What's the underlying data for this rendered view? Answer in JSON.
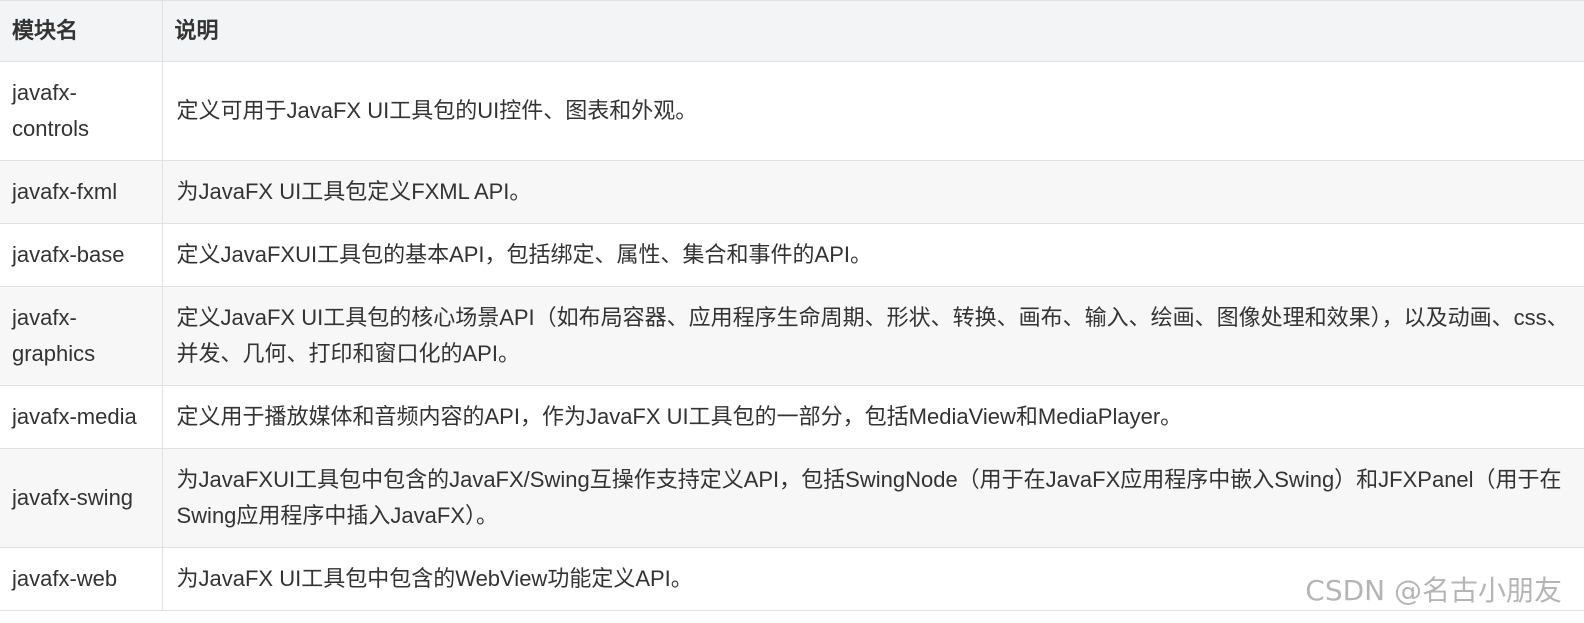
{
  "table": {
    "headers": [
      "模块名",
      "说明"
    ],
    "rows": [
      {
        "module": "javafx-\ncontrols",
        "desc": "定义可用于JavaFX UI工具包的UI控件、图表和外观。"
      },
      {
        "module": "javafx-fxml",
        "desc": "为JavaFX UI工具包定义FXML API。"
      },
      {
        "module": "javafx-base",
        "desc": "定义JavaFXUI工具包的基本API，包括绑定、属性、集合和事件的API。"
      },
      {
        "module": "javafx-\ngraphics",
        "desc": "定义JavaFX UI工具包的核心场景API（如布局容器、应用程序生命周期、形状、转换、画布、输入、绘画、图像处理和效果），以及动画、css、并发、几何、打印和窗口化的API。"
      },
      {
        "module": "javafx-media",
        "desc": "定义用于播放媒体和音频内容的API，作为JavaFX UI工具包的一部分，包括MediaView和MediaPlayer。"
      },
      {
        "module": "javafx-swing",
        "desc": "为JavaFXUI工具包中包含的JavaFX/Swing互操作支持定义API，包括SwingNode（用于在JavaFX应用程序中嵌入Swing）和JFXPanel（用于在Swing应用程序中插入JavaFX）。"
      },
      {
        "module": "javafx-web",
        "desc": "为JavaFX UI工具包中包含的WebView功能定义API。"
      }
    ]
  },
  "watermark": "CSDN @名古小朋友"
}
